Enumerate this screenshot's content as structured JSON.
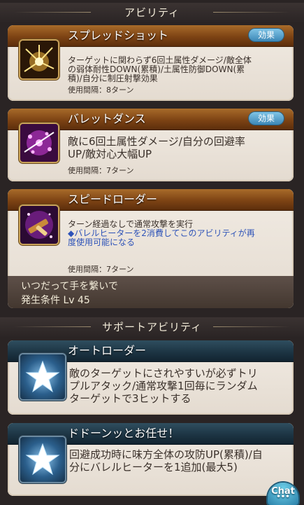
{
  "abilities_header": "アビリティ",
  "support_header": "サポートアビリティ",
  "abilities": [
    {
      "title": "スプレッドショット",
      "badge": "効果",
      "desc_lines": [
        "ターゲットに関わらず6回土属性ダメージ/敵全体",
        "の弱体耐性DOWN(累積)/土属性防御DOWN(累",
        "積)/自分に制圧射撃効果"
      ],
      "cooldown": "使用間隔：8ターン"
    },
    {
      "title": "バレットダンス",
      "badge": "効果",
      "desc_lines": [
        "敵に6回土属性ダメージ/自分の回避率",
        "UP/敵対心大幅UP"
      ],
      "cooldown": "使用間隔：7ターン"
    },
    {
      "title": "スピードローダー",
      "desc_lines": [
        "ターン経過なしで通常攻撃を実行"
      ],
      "note_lines": [
        "◆バレルヒーターを2消費してこのアビリティが再",
        "度使用可能になる"
      ],
      "cooldown": "使用間隔：7ターン",
      "trigger_name": "いつだって手を繋いで",
      "trigger_condition": "発生条件 Lv 45"
    }
  ],
  "supports": [
    {
      "title": "オートローダー",
      "desc_lines": [
        "敵のターゲットにされやすいが必ずトリ",
        "プルアタック/通常攻撃1回毎にランダム",
        "ターゲットで3ヒットする"
      ]
    },
    {
      "title": "ドドーンッとお任せ！",
      "desc_lines": [
        "回避成功時に味方全体の攻防UP(累積)/自",
        "分にバレルヒーターを1追加(最大5)"
      ]
    }
  ],
  "chat_button": "Chat",
  "chat_dots": "•••",
  "icons": [
    "spread-shot-icon",
    "bullet-dance-icon",
    "speed-loader-icon",
    "star-icon",
    "star-icon"
  ]
}
